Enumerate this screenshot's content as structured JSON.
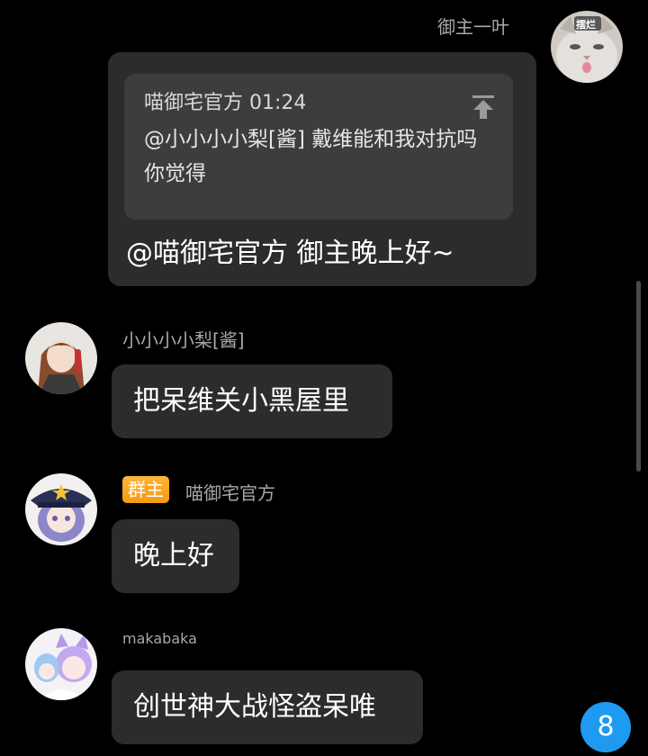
{
  "messages": {
    "m1": {
      "sender": "御主一叶",
      "avatar_badge": "摆烂",
      "quote": {
        "author_time": "喵御宅官方 01:24",
        "text": "@小小小小梨[酱] 戴维能和我对抗吗你觉得"
      },
      "text": "@喵御宅官方 御主晚上好~"
    },
    "m2": {
      "sender": "小小小小梨[酱]",
      "text": "把呆维关小黑屋里"
    },
    "m3": {
      "role_badge": "群主",
      "sender": "喵御宅官方",
      "text": "晚上好"
    },
    "m4": {
      "sender": "makabaka",
      "text": "创世神大战怪盗呆唯"
    }
  },
  "unread_count": "8",
  "colors": {
    "background": "#000000",
    "bubble": "#2c2c2e",
    "quote": "#3d3d40",
    "owner_badge": "#f59a12",
    "unread_badge": "#1e9bf0"
  },
  "icons": {
    "jump_to_quote": "jump-to-top-icon"
  }
}
